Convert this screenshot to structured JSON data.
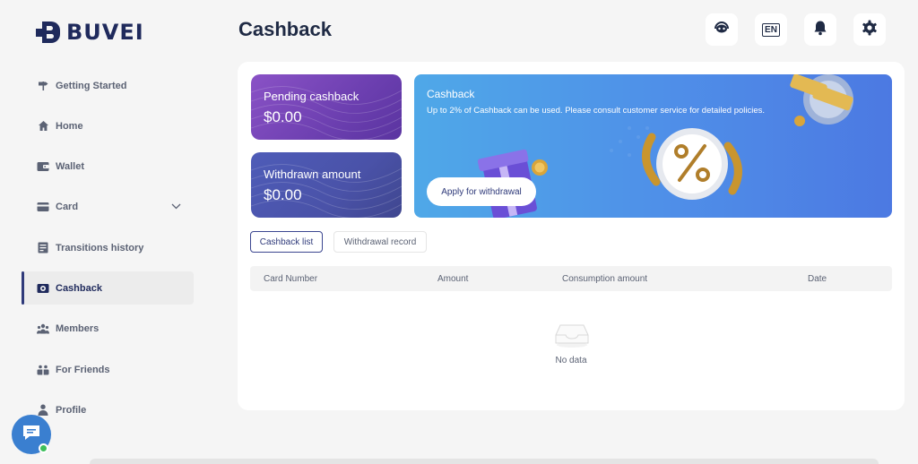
{
  "brand": {
    "name": "BUVEI"
  },
  "sidebar": {
    "items": [
      {
        "label": "Getting Started",
        "icon": "signpost-icon"
      },
      {
        "label": "Home",
        "icon": "home-icon"
      },
      {
        "label": "Wallet",
        "icon": "wallet-icon"
      },
      {
        "label": "Card",
        "icon": "card-icon"
      },
      {
        "label": "Transitions history",
        "icon": "history-icon"
      },
      {
        "label": "Cashback",
        "icon": "cashback-icon"
      },
      {
        "label": "Members",
        "icon": "members-icon"
      },
      {
        "label": "For Friends",
        "icon": "friends-icon"
      },
      {
        "label": "Profile",
        "icon": "profile-icon"
      }
    ],
    "active": "Cashback"
  },
  "header": {
    "title": "Cashback",
    "language": "EN"
  },
  "stats": {
    "pending_label": "Pending cashback",
    "pending_value": "$0.00",
    "withdrawn_label": "Withdrawn amount",
    "withdrawn_value": "$0.00"
  },
  "banner": {
    "title": "Cashback",
    "description": "Up to 2% of Cashback can be used. Please consult customer service for detailed policies.",
    "button": "Apply for withdrawal"
  },
  "tabs": [
    {
      "label": "Cashback list",
      "active": true
    },
    {
      "label": "Withdrawal record",
      "active": false
    }
  ],
  "table": {
    "columns": [
      "Card Number",
      "Amount",
      "Consumption amount",
      "Date"
    ],
    "empty_text": "No data"
  },
  "colors": {
    "brand": "#1f2a5c",
    "accent": "#3b4690",
    "pending_card": "#7a48bc",
    "withdrawn_card": "#4a52a8",
    "banner": "#4f8ee8"
  }
}
